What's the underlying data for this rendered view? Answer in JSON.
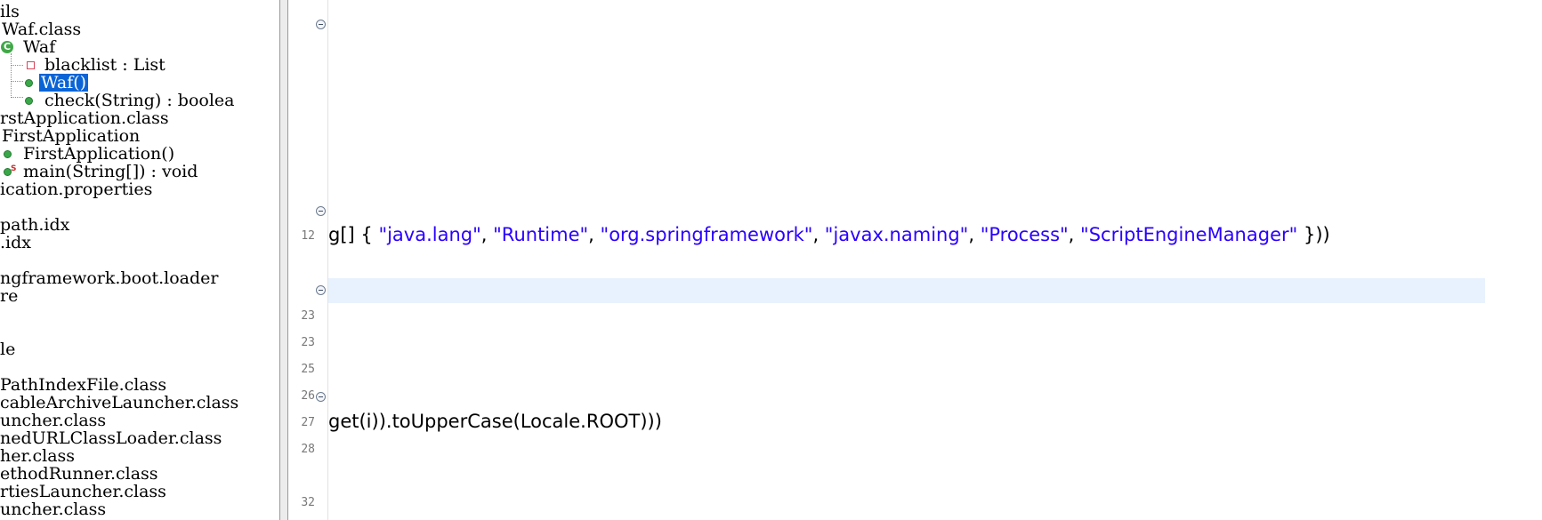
{
  "tree": {
    "rows": [
      {
        "text": "ils",
        "icon": "none"
      },
      {
        "text": "Waf.class",
        "icon": "none"
      },
      {
        "text": "Waf",
        "icon": "class-icon"
      },
      {
        "text": "blacklist : List",
        "icon": "field-icon"
      },
      {
        "text": "Waf()",
        "icon": "method-icon",
        "selected": true
      },
      {
        "text": "check(String) : boolea",
        "icon": "method-icon"
      },
      {
        "text": "rstApplication.class",
        "icon": "none"
      },
      {
        "text": "FirstApplication",
        "icon": "none"
      },
      {
        "text": "FirstApplication()",
        "icon": "method-icon"
      },
      {
        "text": "main(String[]) : void",
        "icon": "static-method-icon"
      },
      {
        "text": "ication.properties",
        "icon": "none"
      },
      {
        "text": "",
        "icon": "none"
      },
      {
        "text": "path.idx",
        "icon": "none"
      },
      {
        "text": ".idx",
        "icon": "none"
      },
      {
        "text": "",
        "icon": "none"
      },
      {
        "text": "ngframework.boot.loader",
        "icon": "none"
      },
      {
        "text": "re",
        "icon": "none"
      },
      {
        "text": "",
        "icon": "none"
      },
      {
        "text": "le",
        "icon": "none"
      },
      {
        "text": "",
        "icon": "none"
      },
      {
        "text": "PathIndexFile.class",
        "icon": "none"
      },
      {
        "text": "cableArchiveLauncher.class",
        "icon": "none"
      },
      {
        "text": "uncher.class",
        "icon": "none"
      },
      {
        "text": "nedURLClassLoader.class",
        "icon": "none"
      },
      {
        "text": "her.class",
        "icon": "none"
      },
      {
        "text": "ethodRunner.class",
        "icon": "none"
      },
      {
        "text": "rtiesLauncher.class",
        "icon": "none"
      },
      {
        "text": "uncher.class",
        "icon": "none"
      }
    ]
  },
  "editor": {
    "line_numbers": [
      {
        "n": "12"
      },
      {
        "n": "23"
      },
      {
        "n": "23"
      },
      {
        "n": "25"
      },
      {
        "n": "26"
      },
      {
        "n": "27"
      },
      {
        "n": "28"
      },
      {
        "n": "32"
      }
    ],
    "code_line_12": {
      "prefix": "g[] { ",
      "s1": "\"java.lang\"",
      "sep1": ", ",
      "s2": "\"Runtime\"",
      "sep2": ", ",
      "s3": "\"org.springframework\"",
      "sep3": ", ",
      "s4": "\"javax.naming\"",
      "sep4": ", ",
      "s5": "\"Process\"",
      "sep5": ", ",
      "s6": "\"ScriptEngineManager\"",
      "suffix": " }))"
    },
    "code_line_27": "get(i)).toUpperCase(Locale.ROOT)))",
    "colors": {
      "string": "#2a00ff",
      "selection": "#0a64d6",
      "current_line": "#e8f2fe"
    }
  }
}
